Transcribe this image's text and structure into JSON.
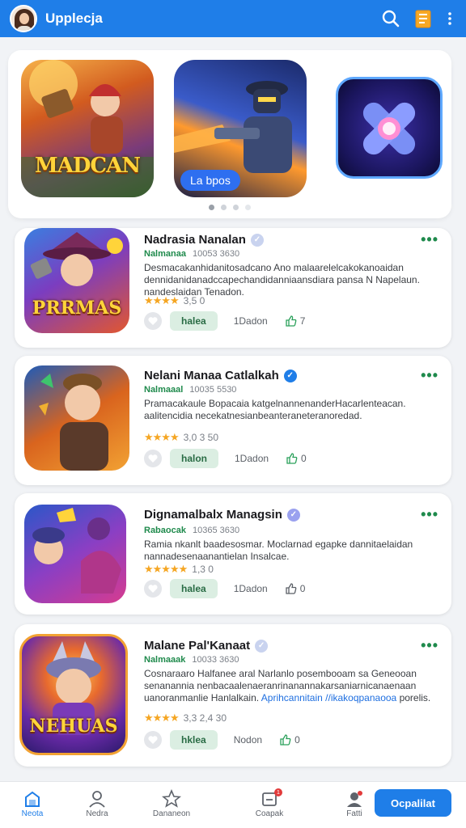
{
  "header": {
    "title": "Upplecja",
    "accent": "#1f7ee8",
    "icons": [
      "avatar",
      "search-icon",
      "clipboard-icon",
      "more-vert-icon"
    ]
  },
  "carousel": {
    "banners": [
      {
        "title": "MADCAN"
      },
      {
        "pill": "La bpos"
      },
      {
        "title": ""
      }
    ],
    "dots": 4,
    "active_dot": 0
  },
  "cards": [
    {
      "title": "Nadrasia Nanalan",
      "publisher": "Nalmanaa",
      "meta": "10053 3630",
      "description": "Desmacakanhidanitosadcano Ano malaarelelcakokanoaidan dennidanidanadccapechandidanniaansdiara pansa N Napelaun. nandeslaidan Tenadon.",
      "rating": "3,5 0",
      "chip": "halea",
      "downloads": "1Dadon",
      "likes": "7",
      "thumb_title": "PRRMAS",
      "verified_color": "#c9d3ef"
    },
    {
      "title": "Nelani  Manaa Catlalkah",
      "publisher": "Nalmaaal",
      "meta": "10035 5530",
      "description": "Pramacakaule Bopacaia katgelnannenanderHacarlenteacan. aalitencidia necekatnesianbeanteraneteranoredad.",
      "rating": "3,0 3 50",
      "chip": "halon",
      "downloads": "1Dadon",
      "likes": "0",
      "thumb_title": "",
      "verified_color": "#1f7ee8"
    },
    {
      "title": "Dignamalbalx Managsin",
      "publisher": "Rabaocak",
      "meta": "10365 3630",
      "description": "Ramia nkanlt baadesosmar. Moclarnad egapke dannitaelaidan nannadesenaanantielan Insalcae.",
      "rating": "1,3 0",
      "chip": "halea",
      "downloads": "1Dadon",
      "likes": "0",
      "thumb_title": "",
      "verified_color": "#9aa1ef"
    },
    {
      "title": "Malane Pal'Kanaat",
      "publisher": "Nalmaaak",
      "meta": "10033 3630",
      "description": "Cosnaraaro Halfanee aral Narlanlo posembooam sa Geneooan senanannia nenbacaalenaeranrinanannakarsaniarnicanaenaan uanoranmanlie Hanlalkain. ",
      "desc_link": "Aprihcannitain //ikakoqpanaooa",
      "desc_tail": "porelis.",
      "rating": "3,3 2,4 30",
      "chip": "hklea",
      "downloads": "Nodon",
      "likes": "0",
      "thumb_title": "NEHUAS",
      "verified_color": "#c9d3ef"
    }
  ],
  "bottom_nav": {
    "items": [
      {
        "label": "Neota",
        "icon": "library-icon",
        "active": true
      },
      {
        "label": "Nedra",
        "icon": "person-icon",
        "active": false
      },
      {
        "label": "Dananeon",
        "icon": "star-icon",
        "active": false
      },
      {
        "label": "Coapak",
        "icon": "inbox-icon",
        "active": false,
        "badge": "1"
      },
      {
        "label": "Fatti",
        "icon": "cloud-user-icon",
        "active": false
      }
    ],
    "cta": "Ocpalilat"
  }
}
